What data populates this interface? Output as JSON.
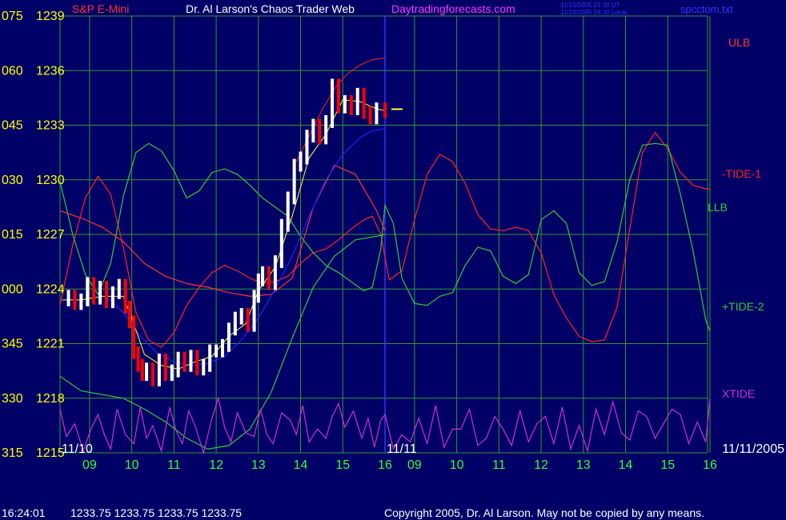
{
  "header": {
    "instrument": "S&P E-Mini",
    "title": "Dr. Al Larson's Chaos Trader Web",
    "site": "Daytradingforecasts.com",
    "stamp_ut": "11/10/2005 21:30 UT",
    "stamp_local": "11/10/2005 16:30 Local",
    "file": "spcctom.txt"
  },
  "footer": {
    "time": "16:24:01",
    "quote": "1233.75 1233.75 1233.75 1233.75",
    "copyright": "Copyright 2005, Dr. Al Larson. May not be copied by any means."
  },
  "colors": {
    "background": "#000066",
    "grid": "#339933",
    "axis_text": "#ffff00",
    "time_text": "#33ff33",
    "ulb": "#ff3333",
    "llb": "#33cc33",
    "tide_neg1": "#ff2222",
    "tide_pos2": "#33cc33",
    "xtide": "#cc33cc",
    "price_up": "#ffffff",
    "price_down": "#ff0000",
    "moving_avg": "#ffff33",
    "envelope_upper": "#cc2222",
    "envelope_lower": "#2222ff",
    "divider": "#3333ff",
    "header_red": "#ff3333",
    "header_white": "#ffffff",
    "header_magenta": "#ff33ff",
    "header_blue": "#3333ff"
  },
  "chart_data": {
    "type": "line",
    "y_ticks": [
      {
        "deg": "075",
        "price": "1239"
      },
      {
        "deg": "060",
        "price": "1236"
      },
      {
        "deg": "045",
        "price": "1233"
      },
      {
        "deg": "030",
        "price": "1230"
      },
      {
        "deg": "015",
        "price": "1227"
      },
      {
        "deg": "000",
        "price": "1224"
      },
      {
        "deg": "345",
        "price": "1221"
      },
      {
        "deg": "330",
        "price": "1218"
      },
      {
        "deg": "315",
        "price": "1215"
      }
    ],
    "ylim": [
      1215,
      1239
    ],
    "x_ticks": [
      "09",
      "10",
      "11",
      "12",
      "13",
      "14",
      "15",
      "16",
      "09",
      "10",
      "11",
      "12",
      "13",
      "14",
      "15",
      "16"
    ],
    "x_range_hours": [
      8.3,
      16
    ],
    "date_labels": [
      "11/10",
      "11/11",
      "11/11/2005"
    ],
    "grid": true,
    "legend": [
      {
        "name": "ULB",
        "key": "ulb"
      },
      {
        "name": "-TIDE-1",
        "key": "tide_neg1"
      },
      {
        "name": "LLB",
        "key": "llb"
      },
      {
        "name": "+TIDE-2",
        "key": "tide_pos2"
      },
      {
        "name": "XTIDE",
        "key": "xtide"
      }
    ],
    "last_price": 1233.75,
    "price_series": {
      "day": "11/10",
      "x": [
        8.35,
        8.5,
        8.65,
        8.8,
        8.95,
        9.1,
        9.25,
        9.4,
        9.55,
        9.7,
        9.85,
        9.95,
        10.05,
        10.15,
        10.25,
        10.35,
        10.5,
        10.65,
        10.8,
        10.95,
        11.1,
        11.25,
        11.4,
        11.55,
        11.7,
        11.85,
        12.0,
        12.15,
        12.3,
        12.45,
        12.6,
        12.75,
        12.9,
        13.0,
        13.1,
        13.25,
        13.4,
        13.55,
        13.7,
        13.85,
        14.0,
        14.15,
        14.3,
        14.45,
        14.6,
        14.75,
        14.9,
        15.05,
        15.2,
        15.35,
        15.5,
        15.65,
        15.8,
        16.0
      ],
      "close": [
        1223.4,
        1223.6,
        1223.2,
        1223.4,
        1224.3,
        1223.5,
        1224.1,
        1223.3,
        1223.8,
        1224.2,
        1223.0,
        1222.2,
        1220.5,
        1219.8,
        1219.3,
        1219.6,
        1219.0,
        1220.1,
        1219.3,
        1219.5,
        1220.2,
        1219.8,
        1220.3,
        1219.6,
        1219.8,
        1220.6,
        1220.6,
        1220.9,
        1221.8,
        1222.4,
        1222.6,
        1222.0,
        1223.6,
        1224.5,
        1224.9,
        1224.3,
        1225.5,
        1227.5,
        1229.0,
        1230.8,
        1231.2,
        1232.4,
        1233.0,
        1232.3,
        1233.2,
        1235.2,
        1234.0,
        1234.3,
        1233.9,
        1234.7,
        1233.7,
        1233.4,
        1233.9,
        1233.75
      ]
    },
    "moving_average": {
      "x": [
        8.35,
        8.8,
        9.3,
        9.8,
        10.0,
        10.3,
        10.7,
        11.1,
        11.5,
        11.9,
        12.3,
        12.7,
        13.0,
        13.4,
        13.8,
        14.2,
        14.6,
        15.0,
        15.4,
        15.8,
        16.0
      ],
      "y": [
        1223.4,
        1223.4,
        1223.6,
        1223.6,
        1222.4,
        1220.4,
        1219.8,
        1219.6,
        1220.0,
        1220.3,
        1221.4,
        1222.1,
        1223.9,
        1225.2,
        1228.0,
        1231.2,
        1232.5,
        1234.4,
        1234.3,
        1233.9,
        1233.8
      ]
    },
    "envelope_upper": {
      "x": [
        13.9,
        14.2,
        14.5,
        14.8,
        15.1,
        15.4,
        15.7,
        16.0
      ],
      "y": [
        1231.0,
        1232.4,
        1233.8,
        1235.0,
        1235.8,
        1236.3,
        1236.6,
        1236.7
      ]
    },
    "envelope_lower": {
      "x": [
        9.4,
        9.8,
        10.2,
        10.6,
        11.0,
        11.4,
        11.8,
        12.2,
        12.6,
        13.0,
        13.4,
        13.8,
        14.2,
        14.6,
        15.0,
        15.4,
        15.7,
        16.0
      ],
      "y": [
        1223.6,
        1222.7,
        1221.4,
        1220.5,
        1220.0,
        1219.8,
        1219.9,
        1220.3,
        1221.2,
        1222.4,
        1224.0,
        1225.8,
        1228.0,
        1230.0,
        1231.4,
        1232.3,
        1232.7,
        1232.8
      ]
    },
    "cycle_series": [
      {
        "key": "tide_neg1",
        "x": [
          8.3,
          8.6,
          8.9,
          9.2,
          9.5,
          9.8,
          10.1,
          10.4,
          10.7,
          11.0,
          11.3,
          11.6,
          11.9,
          12.2,
          12.5,
          12.8,
          13.1,
          13.4,
          13.7,
          14.0,
          14.3,
          14.6,
          14.9,
          15.2,
          15.5,
          15.7,
          15.9,
          16.1,
          16.4,
          16.7,
          17.0,
          17.3,
          17.6,
          17.9,
          18.2,
          18.5,
          18.8,
          19.1,
          19.4,
          19.7,
          20.0,
          20.3,
          20.6,
          20.9,
          21.2,
          21.5,
          21.8,
          22.1,
          22.4,
          22.7,
          23.0,
          23.3,
          23.6,
          23.7
        ],
        "y": [
          1223.1,
          1226.4,
          1229.0,
          1230.2,
          1229.2,
          1226.3,
          1222.7,
          1221.2,
          1220.8,
          1221.6,
          1223.1,
          1224.1,
          1224.9,
          1225.3,
          1225.0,
          1224.6,
          1224.3,
          1224.4,
          1224.7,
          1225.4,
          1226.0,
          1226.2,
          1226.7,
          1227.3,
          1227.8,
          1228.0,
          1227.0,
          1224.5,
          1225.0,
          1227.8,
          1230.3,
          1231.4,
          1231.0,
          1229.8,
          1228.1,
          1227.3,
          1227.2,
          1227.4,
          1227.2,
          1226.0,
          1223.7,
          1222.4,
          1221.4,
          1221.1,
          1221.2,
          1223.0,
          1227.3,
          1231.5,
          1232.6,
          1231.7,
          1230.4,
          1229.7,
          1229.5,
          1229.5
        ]
      },
      {
        "key": "tide_pos2",
        "x": [
          8.3,
          8.6,
          8.9,
          9.2,
          9.5,
          9.8,
          10.1,
          10.4,
          10.7,
          11.0,
          11.3,
          11.6,
          11.9,
          12.2,
          12.5,
          12.8,
          13.1,
          13.4,
          13.7,
          14.0,
          14.3,
          14.6,
          14.9,
          15.2,
          15.5,
          15.7,
          15.9,
          16.0,
          16.2,
          16.4,
          16.7,
          17.0,
          17.3,
          17.6,
          17.9,
          18.2,
          18.5,
          18.8,
          19.1,
          19.4,
          19.7,
          20.0,
          20.3,
          20.6,
          20.9,
          21.2,
          21.5,
          21.8,
          22.1,
          22.4,
          22.7,
          23.0,
          23.3,
          23.6,
          23.7
        ],
        "y": [
          1229.9,
          1227.0,
          1224.8,
          1223.7,
          1225.4,
          1229.1,
          1231.5,
          1232.0,
          1231.6,
          1230.5,
          1229.0,
          1229.4,
          1230.4,
          1230.6,
          1230.3,
          1229.7,
          1229.0,
          1228.5,
          1228.0,
          1226.9,
          1226.0,
          1225.3,
          1224.9,
          1224.4,
          1223.9,
          1224.1,
          1226.2,
          1228.6,
          1227.6,
          1224.6,
          1223.2,
          1223.1,
          1223.6,
          1223.8,
          1225.3,
          1226.3,
          1226.1,
          1224.7,
          1224.3,
          1224.8,
          1227.8,
          1228.3,
          1227.6,
          1224.9,
          1224.2,
          1224.4,
          1226.6,
          1230.0,
          1231.9,
          1232.0,
          1231.9,
          1229.2,
          1226.1,
          1222.3,
          1221.7
        ]
      },
      {
        "key": "ulb",
        "x": [
          8.3,
          8.8,
          9.3,
          9.8,
          10.3,
          10.8,
          11.3,
          11.8,
          12.3,
          12.8,
          13.3,
          13.8,
          14.3,
          14.8,
          15.3,
          15.8,
          16.0
        ],
        "y": [
          1228.3,
          1227.9,
          1227.4,
          1226.6,
          1225.4,
          1224.7,
          1224.3,
          1224.1,
          1223.8,
          1223.6,
          1223.7,
          1224.6,
          1228.5,
          1230.8,
          1230.3,
          1228.3,
          1227.2
        ]
      },
      {
        "key": "llb",
        "x": [
          8.3,
          8.8,
          9.3,
          9.8,
          10.3,
          10.8,
          11.3,
          11.8,
          12.3,
          12.8,
          13.3,
          13.8,
          14.3,
          14.8,
          15.3,
          15.8,
          16.0
        ],
        "y": [
          1219.2,
          1218.4,
          1218.2,
          1218.0,
          1217.4,
          1216.7,
          1215.8,
          1215.2,
          1215.4,
          1216.3,
          1218.3,
          1221.3,
          1224.1,
          1225.8,
          1226.7,
          1226.9,
          1227.0
        ]
      }
    ],
    "xtide": {
      "x": [
        8.3,
        8.45,
        8.65,
        8.85,
        9.05,
        9.2,
        9.35,
        9.5,
        9.65,
        9.85,
        10.05,
        10.2,
        10.35,
        10.5,
        10.7,
        10.9,
        11.05,
        11.2,
        11.35,
        11.5,
        11.7,
        11.9,
        12.05,
        12.2,
        12.35,
        12.5,
        12.7,
        12.9,
        13.05,
        13.2,
        13.35,
        13.55,
        13.75,
        13.9,
        14.05,
        14.2,
        14.4,
        14.6,
        14.75,
        14.9,
        15.05,
        15.25,
        15.45,
        15.6,
        15.75,
        15.9,
        16.0,
        16.2,
        16.4,
        16.6,
        16.8,
        17.0,
        17.2,
        17.4,
        17.6,
        17.8,
        18.0,
        18.2,
        18.4,
        18.6,
        18.8,
        19.0,
        19.2,
        19.4,
        19.6,
        19.8,
        20.0,
        20.2,
        20.4,
        20.6,
        20.8,
        21.0,
        21.2,
        21.4,
        21.6,
        21.8,
        22.0,
        22.2,
        22.4,
        22.6,
        22.8,
        23.0,
        23.2,
        23.4,
        23.6,
        23.7
      ],
      "y": [
        1217.4,
        1215.9,
        1216.6,
        1215.1,
        1216.4,
        1217.1,
        1216.0,
        1215.2,
        1217.4,
        1216.0,
        1215.5,
        1217.5,
        1215.8,
        1216.5,
        1215.1,
        1217.5,
        1216.2,
        1215.5,
        1217.3,
        1216.5,
        1215.0,
        1216.9,
        1218.0,
        1216.4,
        1215.6,
        1217.2,
        1216.1,
        1215.9,
        1217.4,
        1216.0,
        1215.5,
        1217.2,
        1216.8,
        1216.0,
        1217.6,
        1215.6,
        1216.3,
        1215.8,
        1217.0,
        1217.7,
        1216.4,
        1217.3,
        1215.8,
        1216.9,
        1215.3,
        1216.8,
        1217.1,
        1215.2,
        1216.0,
        1215.6,
        1216.9,
        1215.5,
        1217.6,
        1215.3,
        1216.3,
        1216.3,
        1217.4,
        1215.4,
        1215.8,
        1217.0,
        1216.3,
        1215.4,
        1217.3,
        1215.6,
        1216.6,
        1217.0,
        1215.5,
        1217.5,
        1215.2,
        1216.5,
        1215.1,
        1217.4,
        1216.0,
        1217.8,
        1216.1,
        1215.7,
        1217.3,
        1217.0,
        1215.8,
        1216.6,
        1217.4,
        1217.1,
        1215.5,
        1216.7,
        1215.6,
        1218.0
      ]
    }
  }
}
